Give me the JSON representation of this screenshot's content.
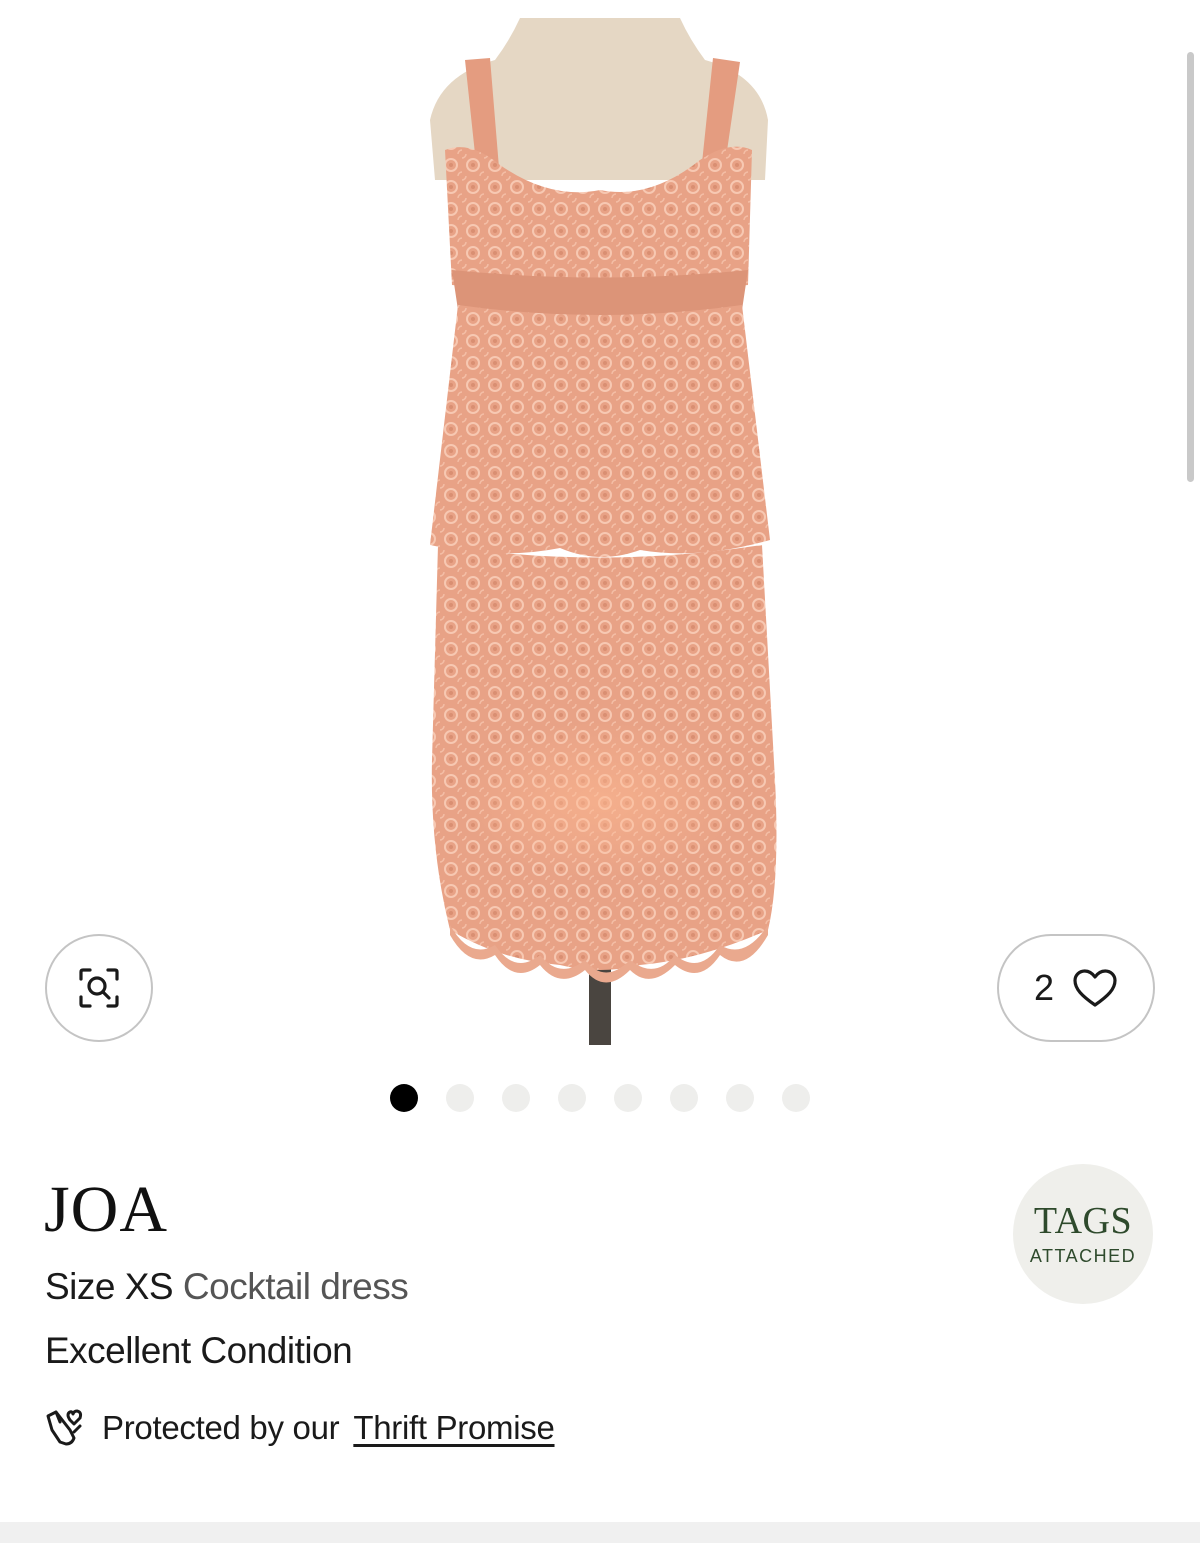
{
  "gallery": {
    "image_alt": "Pink lace cocktail dress on mannequin",
    "dot_count": 8,
    "active_index": 0
  },
  "actions": {
    "zoom_icon": "search-zoom-icon",
    "like_count": "2",
    "like_icon": "heart-icon"
  },
  "product": {
    "brand": "JOA",
    "size": "Size XS",
    "category": "Cocktail dress",
    "condition": "Excellent Condition"
  },
  "badge": {
    "title": "TAGS",
    "subtitle": "ATTACHED",
    "color": "#2e4a2c"
  },
  "promise": {
    "icon": "hand-heart-icon",
    "text": "Protected by our",
    "link": "Thrift Promise"
  },
  "colors": {
    "dress": "#e8a688",
    "dot_active": "#000000",
    "dot_inactive": "#eeeeec"
  }
}
